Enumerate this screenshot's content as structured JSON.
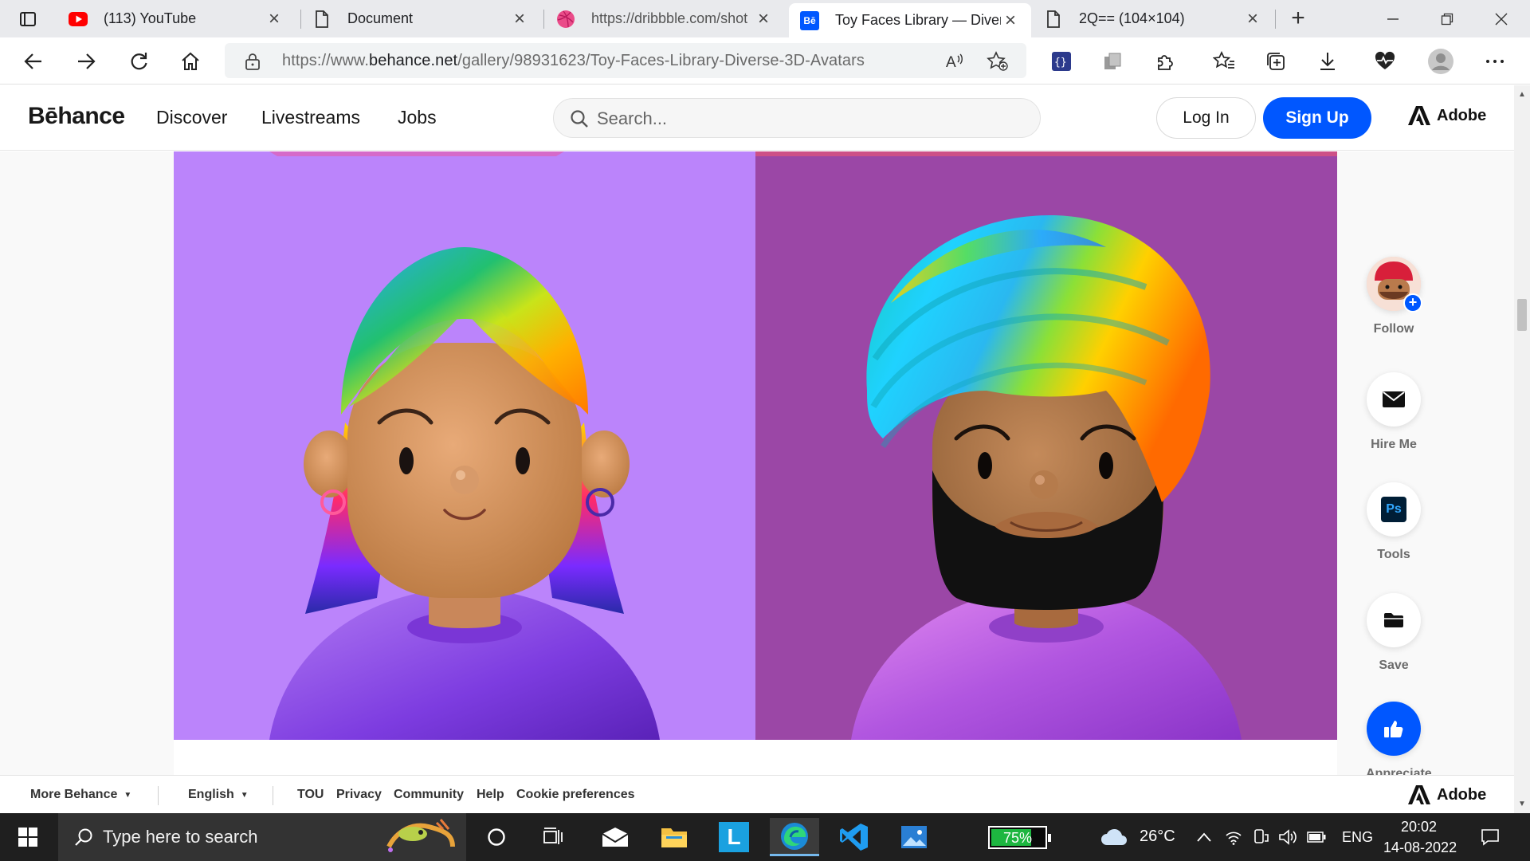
{
  "browser": {
    "tabs": [
      {
        "title": "(113) YouTube",
        "favicon": "youtube-icon",
        "active": false
      },
      {
        "title": "Document",
        "favicon": "document-icon",
        "active": false
      },
      {
        "title": "https://dribbble.com/shot",
        "favicon": "dribbble-icon",
        "active": false
      },
      {
        "title": "Toy Faces Library — Divers",
        "favicon": "behance-icon",
        "favicon_text": "Bē",
        "active": true
      },
      {
        "title": "2Q== (104×104)",
        "favicon": "document-icon",
        "active": false
      }
    ],
    "address": {
      "url_prefix": "https://www.",
      "url_domain": "behance.net",
      "url_path": "/gallery/98931623/Toy-Faces-Library-Diverse-3D-Avatars"
    }
  },
  "behance": {
    "logo": "Bēhance",
    "nav": [
      "Discover",
      "Livestreams",
      "Jobs"
    ],
    "search_placeholder": "Search...",
    "login": "Log In",
    "signup": "Sign Up",
    "adobe": "Adobe",
    "accent_color": "#0057ff"
  },
  "project": {
    "panels": [
      {
        "background": "#bb84fb",
        "avatar": "woman-with-rainbow-hair-and-hoop-earrings"
      },
      {
        "background": "#9b47a6",
        "avatar": "bearded-man-with-rainbow-turban"
      }
    ]
  },
  "side_actions": {
    "follow": "Follow",
    "hire": "Hire Me",
    "tools": "Tools",
    "tools_badge": "Ps",
    "save": "Save",
    "appreciate": "Appreciate"
  },
  "footer": {
    "more": "More Behance",
    "language": "English",
    "links": [
      "TOU",
      "Privacy",
      "Community",
      "Help",
      "Cookie preferences"
    ],
    "adobe": "Adobe"
  },
  "taskbar": {
    "search_placeholder": "Type here to search",
    "launcher_letter": "L",
    "battery_percent": 75,
    "battery_label": "75%",
    "temperature": "26°C",
    "language": "ENG",
    "time": "20:02",
    "date": "14-08-2022"
  }
}
